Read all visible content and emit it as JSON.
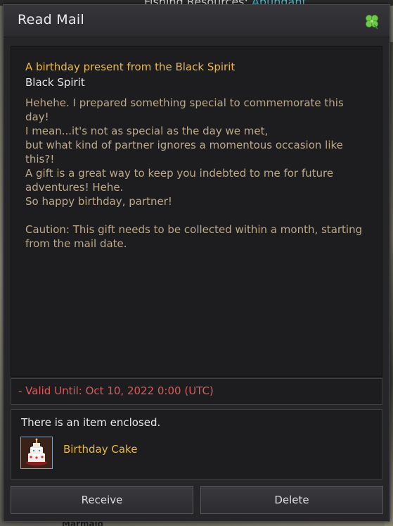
{
  "background": {
    "top_label": "Fishing Resources:",
    "top_value": "Abundant",
    "bottom_label": "Marmalo"
  },
  "window": {
    "title": "Read Mail",
    "icon": "clover-icon"
  },
  "mail": {
    "subject": "A birthday present from the Black Spirit",
    "sender": "Black Spirit",
    "body_lines": [
      "Hehehe. I prepared something special to commemorate this day!",
      "I mean...it's not as special as the day we met,",
      "but what kind of partner ignores a momentous occasion like this?!",
      "A gift is a great way to keep you indebted to me for future adventures! Hehe.",
      "So happy birthday, partner!"
    ],
    "caution": "Caution: This gift needs to be collected within a month, starting from the mail date."
  },
  "validity": "- Valid Until: Oct 10, 2022 0:00 (UTC)",
  "attachment": {
    "note": "There is an item enclosed.",
    "item_name": "Birthday Cake",
    "item_icon": "birthday-cake-icon"
  },
  "buttons": {
    "receive": "Receive",
    "delete": "Delete"
  },
  "colors": {
    "subject": "#e8b84a",
    "body": "#bda98a",
    "validity": "#e05959",
    "item_name": "#e8b84a"
  }
}
